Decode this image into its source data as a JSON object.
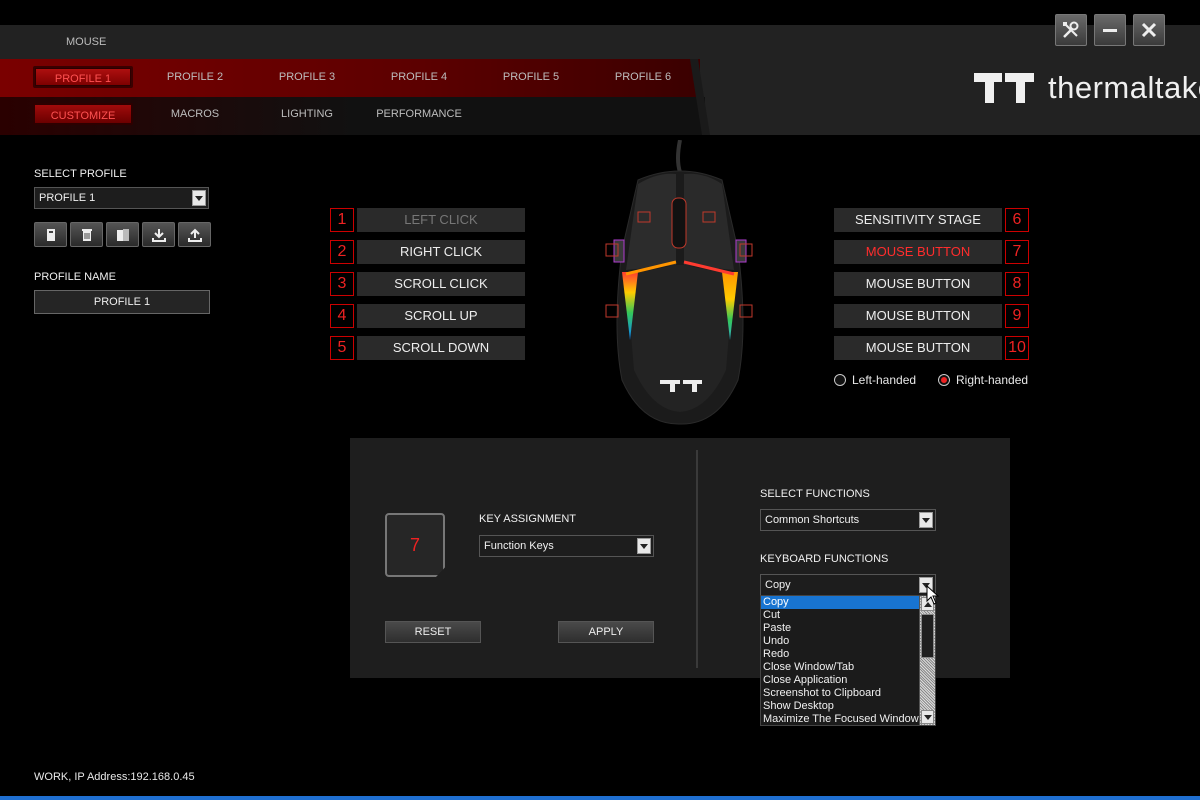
{
  "header": {
    "device_label": "MOUSE",
    "brand": "thermaltake",
    "profiles": [
      "PROFILE 1",
      "PROFILE 2",
      "PROFILE 3",
      "PROFILE 4",
      "PROFILE 5",
      "PROFILE 6"
    ],
    "active_profile_index": 0,
    "subtabs": [
      "CUSTOMIZE",
      "MACROS",
      "LIGHTING",
      "PERFORMANCE"
    ],
    "active_subtab_index": 0,
    "window_buttons": [
      "settings-icon",
      "minimize-icon",
      "close-icon"
    ]
  },
  "left_panel": {
    "select_profile_label": "SELECT PROFILE",
    "selected_profile": "PROFILE 1",
    "toolbar_icons": [
      "new-profile-icon",
      "delete-profile-icon",
      "copy-profile-icon",
      "import-icon",
      "export-icon"
    ],
    "profile_name_label": "PROFILE NAME",
    "profile_name_value": "PROFILE 1"
  },
  "buttons_left": [
    {
      "num": "1",
      "label": "LEFT CLICK",
      "state": "dim"
    },
    {
      "num": "2",
      "label": "RIGHT CLICK",
      "state": "normal"
    },
    {
      "num": "3",
      "label": "SCROLL CLICK",
      "state": "normal"
    },
    {
      "num": "4",
      "label": "SCROLL UP",
      "state": "normal"
    },
    {
      "num": "5",
      "label": "SCROLL DOWN",
      "state": "normal"
    }
  ],
  "buttons_right": [
    {
      "num": "6",
      "label": "SENSITIVITY STAGE",
      "state": "normal"
    },
    {
      "num": "7",
      "label": "MOUSE BUTTON",
      "state": "selected"
    },
    {
      "num": "8",
      "label": "MOUSE BUTTON",
      "state": "normal"
    },
    {
      "num": "9",
      "label": "MOUSE BUTTON",
      "state": "normal"
    },
    {
      "num": "10",
      "label": "MOUSE BUTTON",
      "state": "normal"
    }
  ],
  "handedness": {
    "left": "Left-handed",
    "right": "Right-handed",
    "selected": "right"
  },
  "assignment": {
    "selected_key": "7",
    "key_assignment_label": "KEY ASSIGNMENT",
    "key_assignment_value": "Function Keys",
    "reset_label": "RESET",
    "apply_label": "APPLY",
    "select_functions_label": "SELECT FUNCTIONS",
    "select_functions_value": "Common Shortcuts",
    "keyboard_functions_label": "KEYBOARD FUNCTIONS",
    "keyboard_functions_value": "Copy",
    "keyboard_functions_options": [
      "Copy",
      "Cut",
      "Paste",
      "Undo",
      "Redo",
      "Close Window/Tab",
      "Close Application",
      "Screenshot to  Clipboard",
      "Show Desktop",
      "Maximize The Focused Window"
    ],
    "keyboard_functions_highlighted": 0
  },
  "status": {
    "text": "WORK, IP Address:192.168.0.45"
  },
  "colors": {
    "accent_red": "#ff2d2d",
    "highlight_blue": "#1874d1"
  }
}
